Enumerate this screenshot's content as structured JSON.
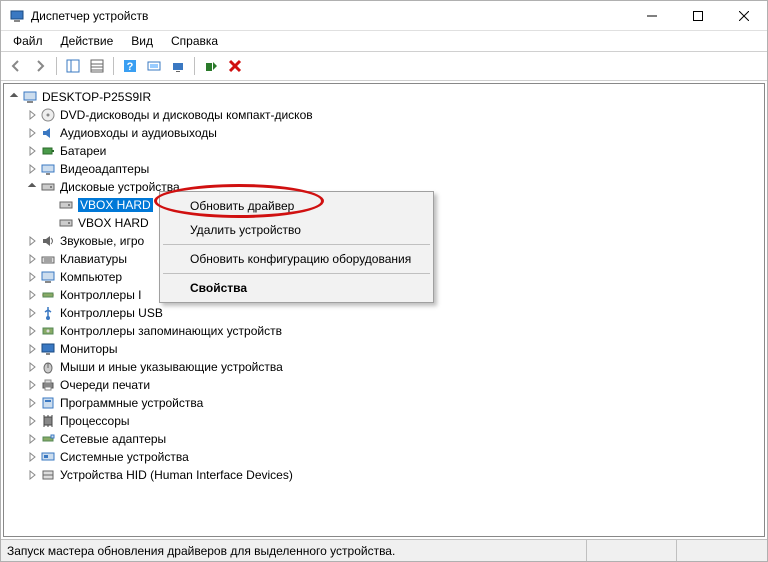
{
  "window": {
    "title": "Диспетчер устройств"
  },
  "menu": {
    "file": "Файл",
    "action": "Действие",
    "view": "Вид",
    "help": "Справка"
  },
  "tree": {
    "root": "DESKTOP-P25S9IR",
    "dvd": "DVD-дисководы и дисководы компакт-дисков",
    "audio": "Аудиовходы и аудиовыходы",
    "battery": "Батареи",
    "video": "Видеоадаптеры",
    "disk": "Дисковые устройства",
    "disk_item1": "VBOX HARD",
    "disk_item2": "VBOX HARD",
    "sound": "Звуковые, игро",
    "keyboard": "Клавиатуры",
    "computer": "Компьютер",
    "ide": "Контроллеры I",
    "usb": "Контроллеры USB",
    "storage": "Контроллеры запоминающих устройств",
    "monitor": "Мониторы",
    "mouse": "Мыши и иные указывающие устройства",
    "print": "Очереди печати",
    "software": "Программные устройства",
    "cpu": "Процессоры",
    "net": "Сетевые адаптеры",
    "system": "Системные устройства",
    "hid": "Устройства HID (Human Interface Devices)"
  },
  "ctx": {
    "update": "Обновить драйвер",
    "remove": "Удалить устройство",
    "rescan": "Обновить конфигурацию оборудования",
    "props": "Свойства"
  },
  "status": {
    "text": "Запуск мастера обновления драйверов для выделенного устройства."
  }
}
